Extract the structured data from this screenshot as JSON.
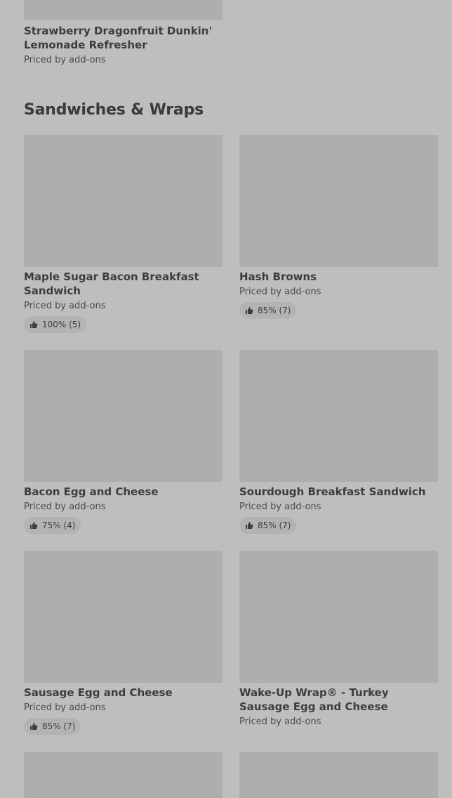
{
  "top_item": {
    "name": "Strawberry Dragonfruit Dunkin' Lemonade Refresher",
    "price": "Priced by add-ons"
  },
  "section": {
    "title": "Sandwiches & Wraps"
  },
  "items": [
    {
      "name": "Maple Sugar Bacon Breakfast Sandwich",
      "price": "Priced by add-ons",
      "rating": "100% (5)"
    },
    {
      "name": "Hash Browns",
      "price": "Priced by add-ons",
      "rating": "85% (7)"
    },
    {
      "name": "Bacon Egg and Cheese",
      "price": "Priced by add-ons",
      "rating": "75% (4)"
    },
    {
      "name": "Sourdough Breakfast Sandwich",
      "price": "Priced by add-ons",
      "rating": "85% (7)"
    },
    {
      "name": "Sausage Egg and Cheese",
      "price": "Priced by add-ons",
      "rating": "85% (7)"
    },
    {
      "name": "Wake-Up Wrap® - Turkey Sausage Egg and Cheese",
      "price": "Priced by add-ons"
    }
  ],
  "icons": {
    "rating": "thumbs-up-icon"
  }
}
